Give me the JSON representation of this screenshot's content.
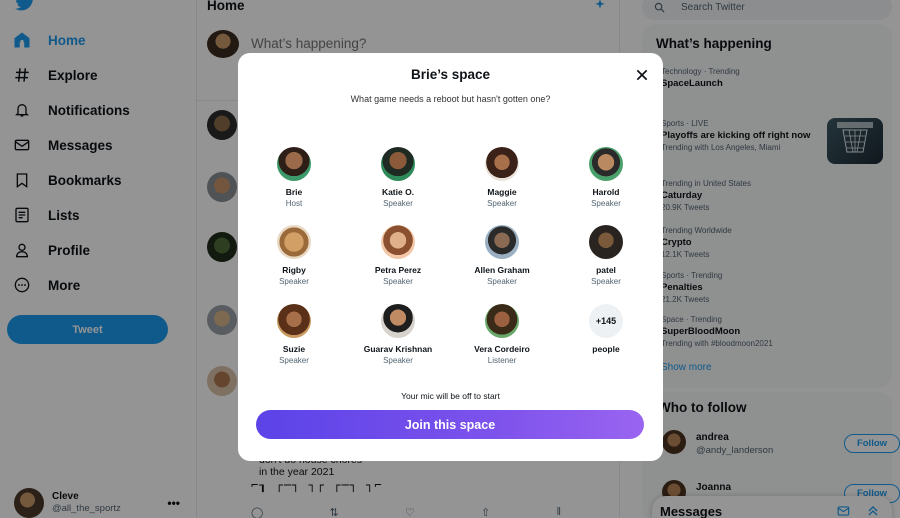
{
  "colors": {
    "brand": "#1d9bf0",
    "join_gradient_start": "#5b43e8",
    "join_gradient_end": "#9a64f0"
  },
  "sidebar": {
    "items": [
      {
        "label": "Home",
        "icon": "home-icon"
      },
      {
        "label": "Explore",
        "icon": "hashtag-icon"
      },
      {
        "label": "Notifications",
        "icon": "bell-icon"
      },
      {
        "label": "Messages",
        "icon": "envelope-icon"
      },
      {
        "label": "Bookmarks",
        "icon": "bookmark-icon"
      },
      {
        "label": "Lists",
        "icon": "list-icon"
      },
      {
        "label": "Profile",
        "icon": "person-icon"
      },
      {
        "label": "More",
        "icon": "more-circle-icon"
      }
    ],
    "tweet_label": "Tweet",
    "account": {
      "name": "Cleve",
      "handle": "@all_the_sportz",
      "menu": "•••"
    }
  },
  "feed": {
    "title": "Home",
    "compose_placeholder": "What’s happening?",
    "tweet_text_line1": "don't do house chores",
    "tweet_text_line2": "in the year 2021",
    "ascii_art": "⌐┒ ┌─┐ ┐┌ ┌─┐ ┐⌐"
  },
  "search": {
    "placeholder": "Search Twitter"
  },
  "trends": {
    "title": "What’s happening",
    "items": [
      {
        "meta": "Technology · Trending",
        "name": "SpaceLaunch",
        "sub": ""
      },
      {
        "meta": "Sports · LIVE",
        "name": "Playoffs are kicking off right now",
        "sub": "Trending with Los Angeles, Miami"
      },
      {
        "meta": "Trending in United States",
        "name": "Caturday",
        "sub": "20.9K Tweets"
      },
      {
        "meta": "Trending Worldwide",
        "name": "Crypto",
        "sub": "12.1K Tweets"
      },
      {
        "meta": "Sports · Trending",
        "name": "Penalties",
        "sub": "21.2K Tweets"
      },
      {
        "meta": "Space · Trending",
        "name": "SuperBloodMoon",
        "sub": "Trending with #bloodmoon2021"
      }
    ],
    "show_more": "Show more"
  },
  "who_to_follow": {
    "title": "Who to follow",
    "users": [
      {
        "name": "andrea",
        "handle": "@andy_landerson",
        "button": "Follow"
      },
      {
        "name": "Joanna",
        "handle": "",
        "button": "Follow"
      }
    ]
  },
  "messages_bar": {
    "title": "Messages"
  },
  "modal": {
    "title": "Brie’s space",
    "subtitle": "What game needs a reboot but hasn't gotten one?",
    "participants": [
      {
        "name": "Brie",
        "role": "Host"
      },
      {
        "name": "Katie O.",
        "role": "Speaker"
      },
      {
        "name": "Maggie",
        "role": "Speaker"
      },
      {
        "name": "Harold",
        "role": "Speaker"
      },
      {
        "name": "Rigby",
        "role": "Speaker"
      },
      {
        "name": "Petra Perez",
        "role": "Speaker"
      },
      {
        "name": "Allen Graham",
        "role": "Speaker"
      },
      {
        "name": "patel",
        "role": "Speaker"
      },
      {
        "name": "Suzie",
        "role": "Speaker"
      },
      {
        "name": "Guarav Krishnan",
        "role": "Speaker"
      },
      {
        "name": "Vera Cordeiro",
        "role": "Listener"
      }
    ],
    "more_count": "+145",
    "more_label": "people",
    "mic_note": "Your mic will be off to start",
    "join_label": "Join this space"
  }
}
